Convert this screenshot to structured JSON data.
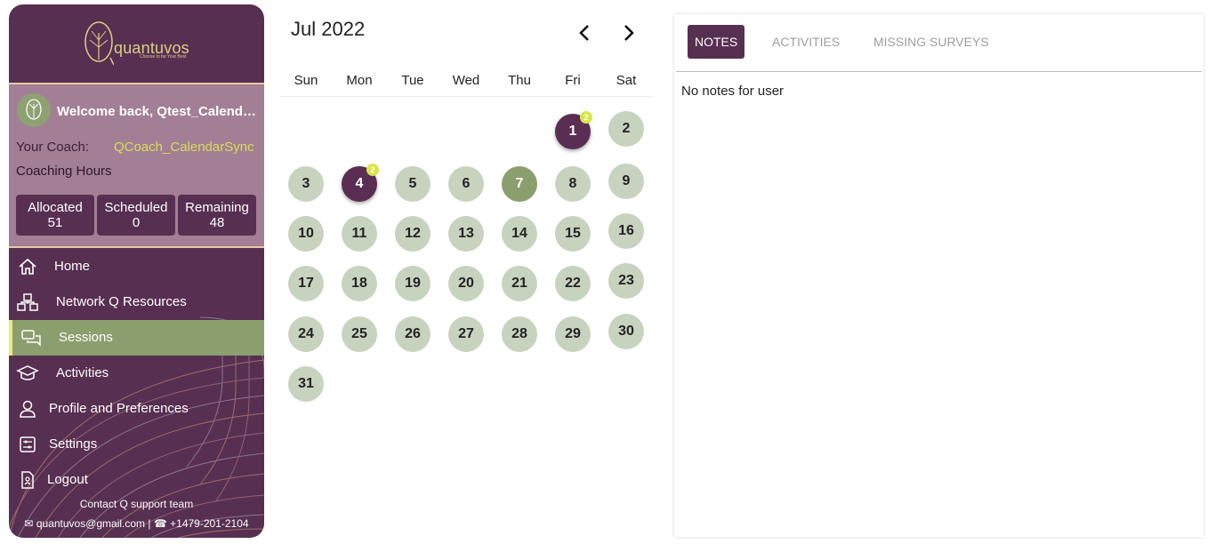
{
  "sidebar": {
    "logo_text": "quantuvos",
    "logo_tagline": "Choose to be Your Best",
    "welcome": "Welcome back, Qtest_CalendarSync",
    "coach_label": "Your Coach:",
    "coach_name": "QCoach_CalendarSync",
    "hours_label": "Coaching Hours",
    "stats": [
      {
        "label": "Allocated",
        "value": "51"
      },
      {
        "label": "Scheduled",
        "value": "0"
      },
      {
        "label": "Remaining",
        "value": "48"
      }
    ],
    "nav": [
      {
        "label": "Home",
        "icon": "home-icon"
      },
      {
        "label": "Network Q Resources",
        "icon": "network-icon"
      },
      {
        "label": "Sessions",
        "icon": "chat-icon"
      },
      {
        "label": "Activities",
        "icon": "graduation-cap-icon"
      },
      {
        "label": "Profile and Preferences",
        "icon": "user-icon"
      },
      {
        "label": "Settings",
        "icon": "settings-icon"
      },
      {
        "label": "Logout",
        "icon": "logout-icon"
      }
    ],
    "active_nav": "Sessions",
    "contact_title": "Contact Q support team",
    "contact_email": "quantuvos@gmail.com",
    "contact_phone": "+1479-201-2104",
    "colors": {
      "primary": "#572f51",
      "accent": "#8b9e6e",
      "highlight": "#d9de58"
    }
  },
  "calendar": {
    "month_label": "Jul 2022",
    "weekdays": [
      "Sun",
      "Mon",
      "Tue",
      "Wed",
      "Thu",
      "Fri",
      "Sat"
    ],
    "days": [
      "1",
      "2",
      "3",
      "4",
      "5",
      "6",
      "7",
      "8",
      "9",
      "10",
      "11",
      "12",
      "13",
      "14",
      "15",
      "16",
      "17",
      "18",
      "19",
      "20",
      "21",
      "22",
      "23",
      "24",
      "25",
      "26",
      "27",
      "28",
      "29",
      "30",
      "31"
    ],
    "first_weekday_index": 5,
    "scheduled_days": {
      "1": "2",
      "4": "2"
    },
    "today": "7"
  },
  "panel": {
    "tabs": [
      "NOTES",
      "ACTIVITIES",
      "MISSING SURVEYS"
    ],
    "active_tab": "NOTES",
    "empty_message": "No notes for user"
  }
}
